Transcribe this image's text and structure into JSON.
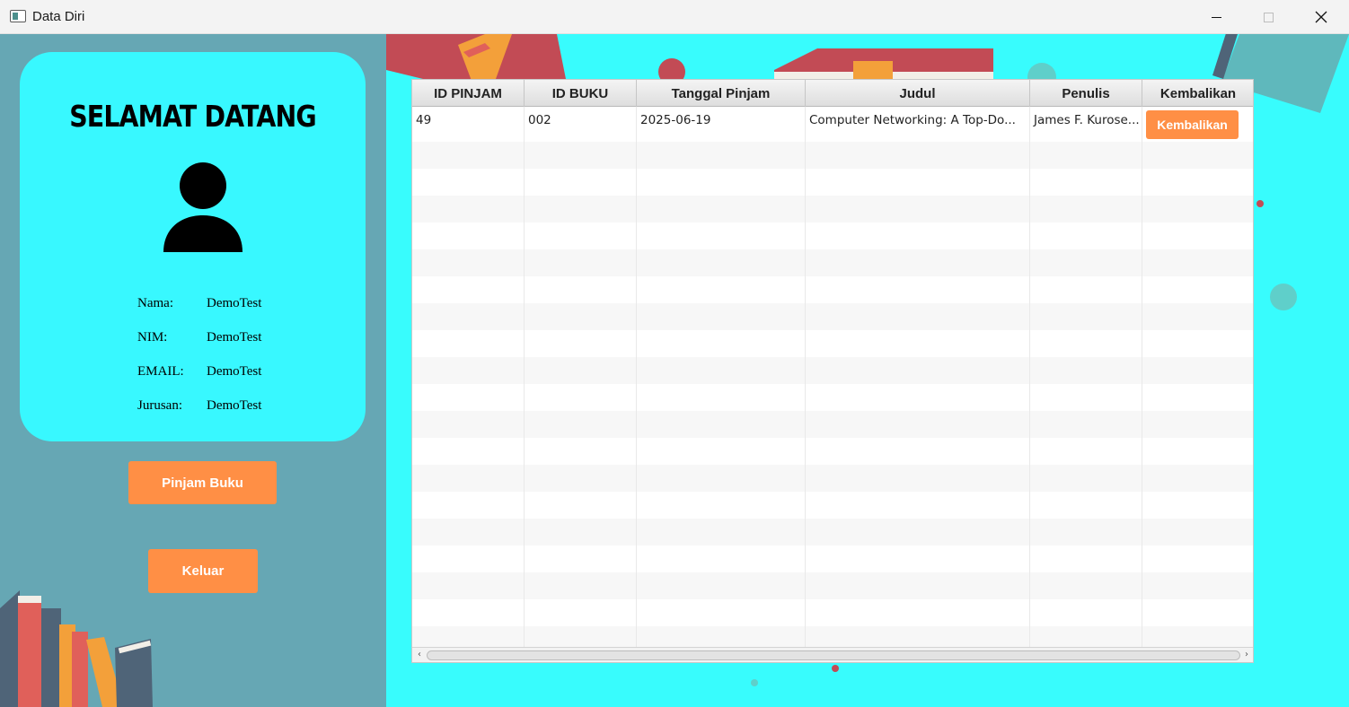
{
  "window": {
    "title": "Data Diri",
    "icon": "app-window-icon",
    "controls": [
      "minimize-icon",
      "maximize-icon",
      "close-icon"
    ]
  },
  "profile": {
    "welcome": "SELAMAT DATANG",
    "avatar_icon": "user-icon",
    "fields": [
      {
        "label": "Nama:",
        "value": "DemoTest"
      },
      {
        "label": "NIM:",
        "value": "DemoTest"
      },
      {
        "label": "EMAIL:",
        "value": "DemoTest"
      },
      {
        "label": "Jurusan:",
        "value": "DemoTest"
      }
    ]
  },
  "actions": {
    "pinjam_label": "Pinjam Buku",
    "keluar_label": "Keluar"
  },
  "table": {
    "columns": [
      "ID PINJAM",
      "ID BUKU",
      "Tanggal Pinjam",
      "Judul",
      "Penulis",
      "Kembalikan"
    ],
    "rows": [
      {
        "id_pinjam": "49",
        "id_buku": "002",
        "tanggal": "2025-06-19",
        "judul": "Computer Networking: A Top-Do...",
        "penulis": "James F. Kurose...",
        "action_label": "Kembalikan"
      }
    ]
  },
  "colors": {
    "card": "#38f8ff",
    "left_bg": "#66a7b4",
    "right_bg": "#38fcfd",
    "button": "#ff8f45"
  }
}
